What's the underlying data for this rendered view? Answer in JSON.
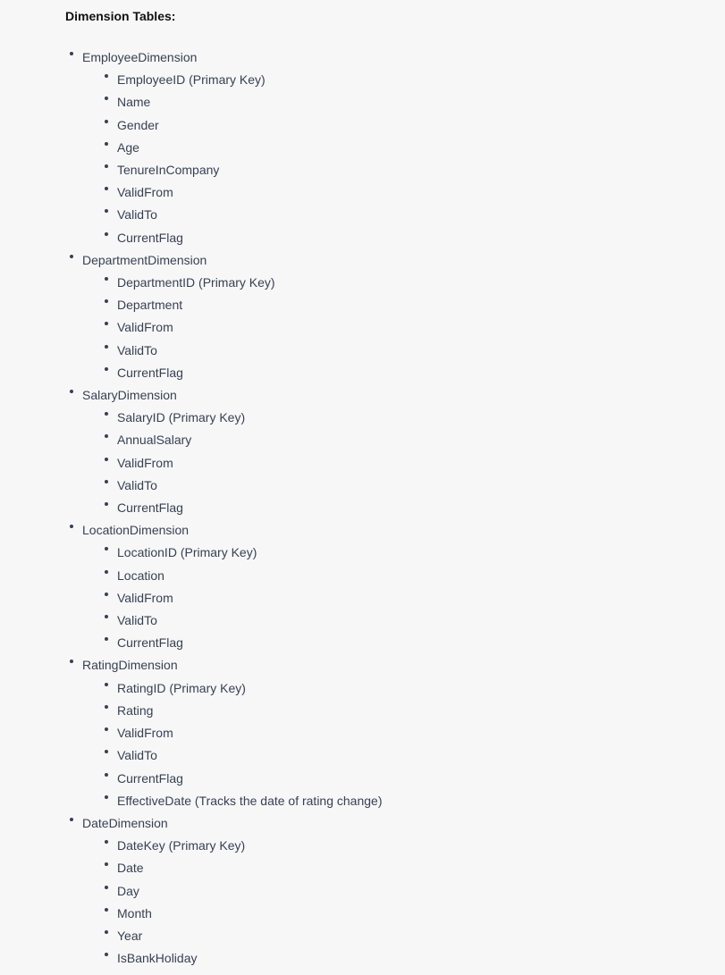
{
  "heading": "Dimension Tables:",
  "tables": [
    {
      "name": "EmployeeDimension",
      "fields": [
        "EmployeeID (Primary Key)",
        "Name",
        "Gender",
        "Age",
        "TenureInCompany",
        "ValidFrom",
        "ValidTo",
        "CurrentFlag"
      ]
    },
    {
      "name": "DepartmentDimension",
      "fields": [
        "DepartmentID (Primary Key)",
        "Department",
        "ValidFrom",
        "ValidTo",
        "CurrentFlag"
      ]
    },
    {
      "name": "SalaryDimension",
      "fields": [
        "SalaryID (Primary Key)",
        "AnnualSalary",
        "ValidFrom",
        "ValidTo",
        "CurrentFlag"
      ]
    },
    {
      "name": "LocationDimension",
      "fields": [
        "LocationID (Primary Key)",
        "Location",
        "ValidFrom",
        "ValidTo",
        "CurrentFlag"
      ]
    },
    {
      "name": "RatingDimension",
      "fields": [
        "RatingID (Primary Key)",
        "Rating",
        "ValidFrom",
        "ValidTo",
        "CurrentFlag",
        "EffectiveDate (Tracks the date of rating change)"
      ]
    },
    {
      "name": "DateDimension",
      "fields": [
        "DateKey (Primary Key)",
        "Date",
        "Day",
        "Month",
        "Year",
        "IsBankHoliday"
      ]
    }
  ]
}
